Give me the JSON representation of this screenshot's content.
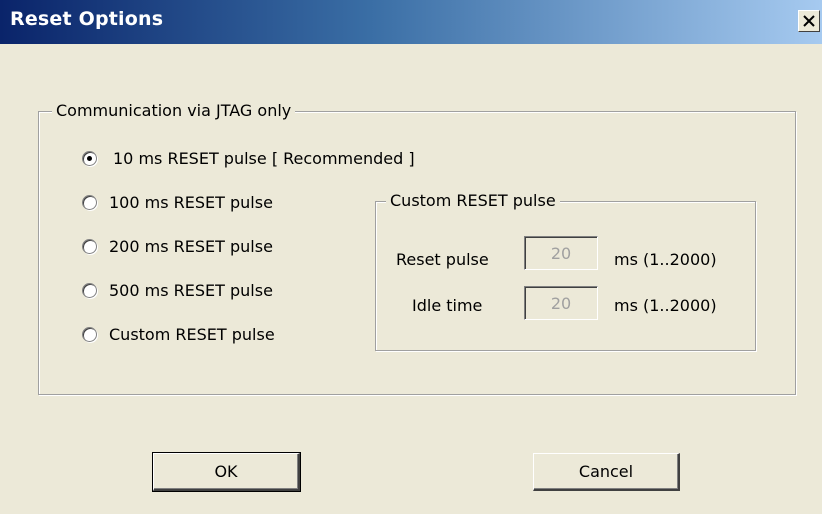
{
  "window": {
    "title": "Reset Options"
  },
  "jtag_group": {
    "label": "Communication via JTAG only",
    "options": [
      {
        "label": "10 ms RESET pulse  [ Recommended ]",
        "checked": true
      },
      {
        "label": "100 ms RESET pulse",
        "checked": false
      },
      {
        "label": "200 ms RESET pulse",
        "checked": false
      },
      {
        "label": "500 ms RESET pulse",
        "checked": false
      },
      {
        "label": "Custom RESET pulse",
        "checked": false
      }
    ]
  },
  "custom_group": {
    "label": "Custom RESET pulse",
    "reset_pulse": {
      "label": "Reset pulse",
      "value": "20",
      "range": "ms (1..2000)"
    },
    "idle_time": {
      "label": "Idle time",
      "value": "20",
      "range": "ms (1..2000)"
    }
  },
  "buttons": {
    "ok": "OK",
    "cancel": "Cancel"
  }
}
